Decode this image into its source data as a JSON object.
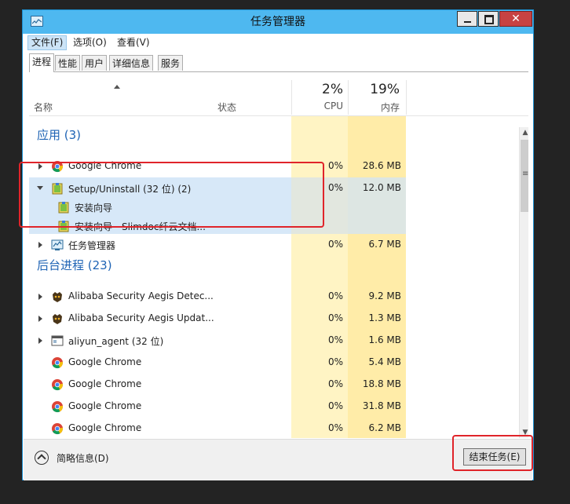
{
  "window": {
    "title": "任务管理器"
  },
  "menu": [
    {
      "label": "文件(F)",
      "active": true
    },
    {
      "label": "选项(O)",
      "active": false
    },
    {
      "label": "查看(V)",
      "active": false
    }
  ],
  "tabs": [
    {
      "label": "进程",
      "selected": true
    },
    {
      "label": "性能",
      "selected": false
    },
    {
      "label": "用户",
      "selected": false
    },
    {
      "label": "详细信息",
      "selected": false
    },
    {
      "label": "服务",
      "selected": false
    }
  ],
  "columns": {
    "name": "名称",
    "status": "状态",
    "cpu": {
      "percent": "2%",
      "label": "CPU"
    },
    "memory": {
      "percent": "19%",
      "label": "内存"
    }
  },
  "apps_group": {
    "title": "应用 (3)"
  },
  "background_group": {
    "title": "后台进程 (23)"
  },
  "rows": [
    {
      "name": "Google Chrome",
      "cpu": "0%",
      "mem": "28.6 MB",
      "icon": "chrome-icon",
      "expander": "collapsed"
    },
    {
      "name": "Setup/Uninstall (32 位) (2)",
      "cpu": "0%",
      "mem": "12.0 MB",
      "icon": "setup-icon",
      "expander": "expanded"
    },
    {
      "name": "安装向导",
      "cpu": "",
      "mem": "",
      "icon": "setup-icon",
      "expander": "none"
    },
    {
      "name": "安装向导 - Slimdoc纤云文档...",
      "cpu": "",
      "mem": "",
      "icon": "setup-icon",
      "expander": "none"
    },
    {
      "name": "任务管理器",
      "cpu": "0%",
      "mem": "6.7 MB",
      "icon": "taskmgr-icon",
      "expander": "collapsed"
    },
    {
      "name": "Alibaba Security Aegis Detec...",
      "cpu": "0%",
      "mem": "9.2 MB",
      "icon": "aegis-icon",
      "expander": "collapsed"
    },
    {
      "name": "Alibaba Security Aegis Updat...",
      "cpu": "0%",
      "mem": "1.3 MB",
      "icon": "aegis-icon",
      "expander": "collapsed"
    },
    {
      "name": "aliyun_agent (32 位)",
      "cpu": "0%",
      "mem": "1.6 MB",
      "icon": "window-icon",
      "expander": "collapsed"
    },
    {
      "name": "Google Chrome",
      "cpu": "0%",
      "mem": "5.4 MB",
      "icon": "chrome-icon",
      "expander": "none"
    },
    {
      "name": "Google Chrome",
      "cpu": "0%",
      "mem": "18.8 MB",
      "icon": "chrome-icon",
      "expander": "none"
    },
    {
      "name": "Google Chrome",
      "cpu": "0%",
      "mem": "31.8 MB",
      "icon": "chrome-icon",
      "expander": "none"
    },
    {
      "name": "Google Chrome",
      "cpu": "0%",
      "mem": "6.2 MB",
      "icon": "chrome-icon",
      "expander": "none"
    }
  ],
  "footer": {
    "fewer_details": "简略信息(D)",
    "end_task": "结束任务(E)"
  },
  "colors": {
    "titlebar": "#4eb8f0",
    "group_title": "#1f64b5",
    "cpu_column": "#fff4c4",
    "memory_column": "#ffeca8",
    "selection": "#d7e8f8",
    "callout": "#e0242a"
  }
}
